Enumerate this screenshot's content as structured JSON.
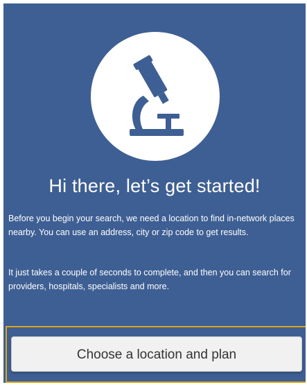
{
  "hero": {
    "icon": "microscope-icon",
    "heading": "Hi there, let’s get started!"
  },
  "intro": {
    "paragraph_1": "Before you begin your search, we need a location to find in-network places nearby. You can use an address, city or zip code to get results.",
    "paragraph_2": "It just takes a couple of seconds to complete, and then you can search for providers, hospitals, specialists and more."
  },
  "cta": {
    "label": "Choose a location and plan"
  },
  "colors": {
    "panel_background": "#3e5f93",
    "icon_color": "#3e5f93",
    "focus_outline": "#d9a617",
    "button_background": "#f1f1f1"
  }
}
